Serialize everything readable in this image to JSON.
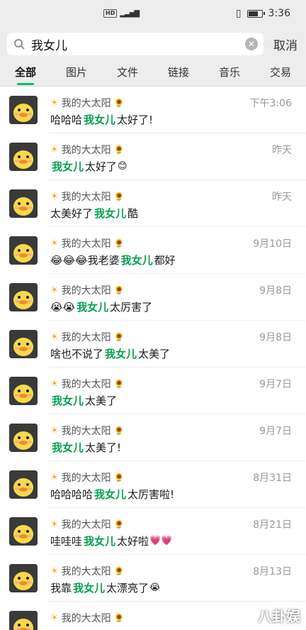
{
  "status": {
    "time": "3:36",
    "hd": "HD"
  },
  "search": {
    "query": "我女儿",
    "cancel": "取消"
  },
  "tabs": [
    "全部",
    "图片",
    "文件",
    "链接",
    "音乐",
    "交易"
  ],
  "contact_name": "我的大太阳",
  "rows": [
    {
      "time": "下午3:06",
      "pre": "哈哈哈 ",
      "hl": "我女儿",
      "post": "太好了!",
      "emoji": ""
    },
    {
      "time": "昨天",
      "pre": "",
      "hl": "我女儿",
      "post": "太好了",
      "emoji": "😊"
    },
    {
      "time": "昨天",
      "pre": "太美好了 ",
      "hl": "我女儿",
      "post": " 酷",
      "emoji": ""
    },
    {
      "time": "9月10日",
      "pre": "😂😂😂我老婆",
      "hl": "我女儿",
      "post": "都好",
      "emoji": ""
    },
    {
      "time": "9月8日",
      "pre": "😭😭",
      "hl": "我女儿",
      "post": "太厉害了",
      "emoji": ""
    },
    {
      "time": "9月8日",
      "pre": "啥也不说了 ",
      "hl": "我女儿",
      "post": "太美了",
      "emoji": ""
    },
    {
      "time": "9月7日",
      "pre": "",
      "hl": "我女儿",
      "post": "太美了",
      "emoji": ""
    },
    {
      "time": "9月7日",
      "pre": "",
      "hl": "我女儿",
      "post": "太美了!",
      "emoji": ""
    },
    {
      "time": "8月31日",
      "pre": "哈哈哈哈 ",
      "hl": "我女儿",
      "post": "太厉害啦!",
      "emoji": ""
    },
    {
      "time": "8月21日",
      "pre": "哇哇哇 ",
      "hl": "我女儿",
      "post": "太好啦",
      "emoji": "💗💗"
    },
    {
      "time": "8月13日",
      "pre": "我靠 ",
      "hl": "我女儿",
      "post": "太漂亮了",
      "emoji": "😭"
    },
    {
      "time": "",
      "pre": "",
      "hl": "",
      "post": "",
      "emoji": ""
    }
  ],
  "watermark": "八卦娱"
}
